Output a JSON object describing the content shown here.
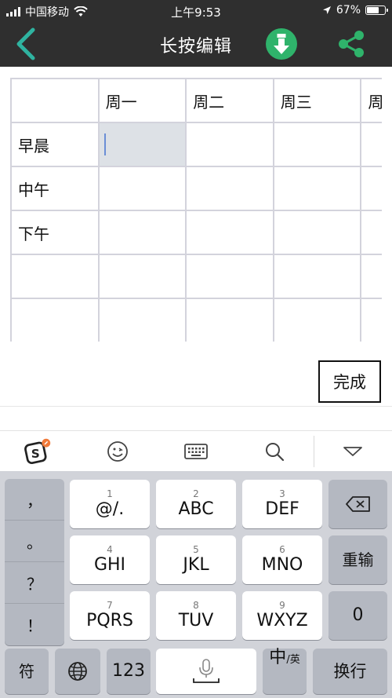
{
  "status_bar": {
    "carrier": "中国移动",
    "time": "上午9:53",
    "battery": "67%",
    "battery_level": 0.67
  },
  "nav": {
    "title": "长按编辑",
    "back_icon": "chevron-left-icon",
    "download_icon": "download-icon",
    "share_icon": "share-icon",
    "accent_color": "#2fb36b"
  },
  "table": {
    "header": [
      "",
      "周一",
      "周二",
      "周三",
      "周四"
    ],
    "rows": [
      [
        "早晨",
        "",
        "",
        "",
        ""
      ],
      [
        "中午",
        "",
        "",
        "",
        ""
      ],
      [
        "下午",
        "",
        "",
        "",
        ""
      ],
      [
        "",
        "",
        "",
        "",
        ""
      ],
      [
        "",
        "",
        "",
        "",
        ""
      ]
    ]
  },
  "done_label": "完成",
  "kb_toolbar": {
    "items": [
      "sogou-logo-icon",
      "emoji-icon",
      "keyboard-icon",
      "search-icon",
      "collapse-icon"
    ]
  },
  "keyboard": {
    "punct": [
      "，",
      "。",
      "？",
      "！"
    ],
    "keys": [
      {
        "num": "1",
        "label": "@/."
      },
      {
        "num": "2",
        "label": "ABC"
      },
      {
        "num": "3",
        "label": "DEF"
      },
      {
        "num": "4",
        "label": "GHI"
      },
      {
        "num": "5",
        "label": "JKL"
      },
      {
        "num": "6",
        "label": "MNO"
      },
      {
        "num": "7",
        "label": "PQRS"
      },
      {
        "num": "8",
        "label": "TUV"
      },
      {
        "num": "9",
        "label": "WXYZ"
      }
    ],
    "backspace_icon": "backspace-icon",
    "reinput": "重输",
    "zero": "0",
    "symbol": "符",
    "globe_icon": "globe-icon",
    "num_mode": "123",
    "mic_icon": "microphone-icon",
    "lang_main": "中",
    "lang_sub": "/英",
    "enter": "换行"
  }
}
